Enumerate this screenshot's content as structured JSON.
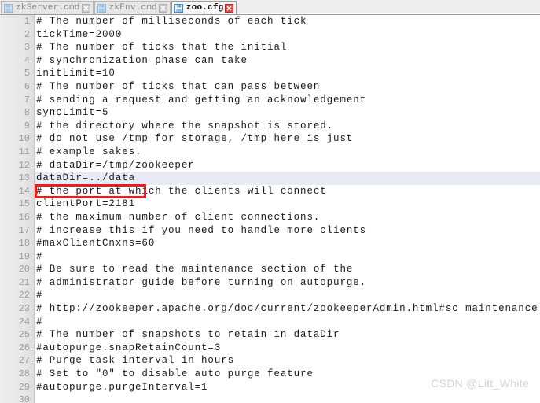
{
  "window": {
    "title": "zoo.cfg",
    "accent_red": "#e81f1f",
    "highlight_row_color": "#e8eaf6",
    "gutter_color": "#e7e7e7"
  },
  "tabbar": {
    "tabs": [
      {
        "label": "zkServer.cmd",
        "icon": "save-floppy-icon",
        "close_icon": "close-icon",
        "active": false
      },
      {
        "label": "zkEnv.cmd",
        "icon": "save-floppy-icon",
        "close_icon": "close-icon",
        "active": false
      },
      {
        "label": "zoo.cfg",
        "icon": "save-floppy-icon",
        "close_icon": "close-icon",
        "active": true
      }
    ]
  },
  "editor": {
    "lines": [
      {
        "n": "1",
        "text": "# The number of milliseconds of each tick"
      },
      {
        "n": "2",
        "text": "tickTime=2000"
      },
      {
        "n": "3",
        "text": "# The number of ticks that the initial"
      },
      {
        "n": "4",
        "text": "# synchronization phase can take"
      },
      {
        "n": "5",
        "text": "initLimit=10"
      },
      {
        "n": "6",
        "text": "# The number of ticks that can pass between"
      },
      {
        "n": "7",
        "text": "# sending a request and getting an acknowledgement"
      },
      {
        "n": "8",
        "text": "syncLimit=5"
      },
      {
        "n": "9",
        "text": "# the directory where the snapshot is stored."
      },
      {
        "n": "10",
        "text": "# do not use /tmp for storage, /tmp here is just"
      },
      {
        "n": "11",
        "text": "# example sakes."
      },
      {
        "n": "12",
        "text": "# dataDir=/tmp/zookeeper"
      },
      {
        "n": "13",
        "text": "dataDir=../data",
        "highlight": true,
        "annotated": true
      },
      {
        "n": "14",
        "text": "# the port at which the clients will connect"
      },
      {
        "n": "15",
        "text": "clientPort=2181"
      },
      {
        "n": "16",
        "text": "# the maximum number of client connections."
      },
      {
        "n": "17",
        "text": "# increase this if you need to handle more clients"
      },
      {
        "n": "18",
        "text": "#maxClientCnxns=60"
      },
      {
        "n": "19",
        "text": "#"
      },
      {
        "n": "20",
        "text": "# Be sure to read the maintenance section of the"
      },
      {
        "n": "21",
        "text": "# administrator guide before turning on autopurge."
      },
      {
        "n": "22",
        "text": "#"
      },
      {
        "n": "23",
        "text": "# http://zookeeper.apache.org/doc/current/zookeeperAdmin.html#sc_maintenance",
        "link": true
      },
      {
        "n": "24",
        "text": "#"
      },
      {
        "n": "25",
        "text": "# The number of snapshots to retain in dataDir"
      },
      {
        "n": "26",
        "text": "#autopurge.snapRetainCount=3"
      },
      {
        "n": "27",
        "text": "# Purge task interval in hours"
      },
      {
        "n": "28",
        "text": "# Set to \"0\" to disable auto purge feature"
      },
      {
        "n": "29",
        "text": "#autopurge.purgeInterval=1"
      },
      {
        "n": "30",
        "text": ""
      }
    ]
  },
  "watermark": {
    "text": "CSDN @Litt_White"
  }
}
